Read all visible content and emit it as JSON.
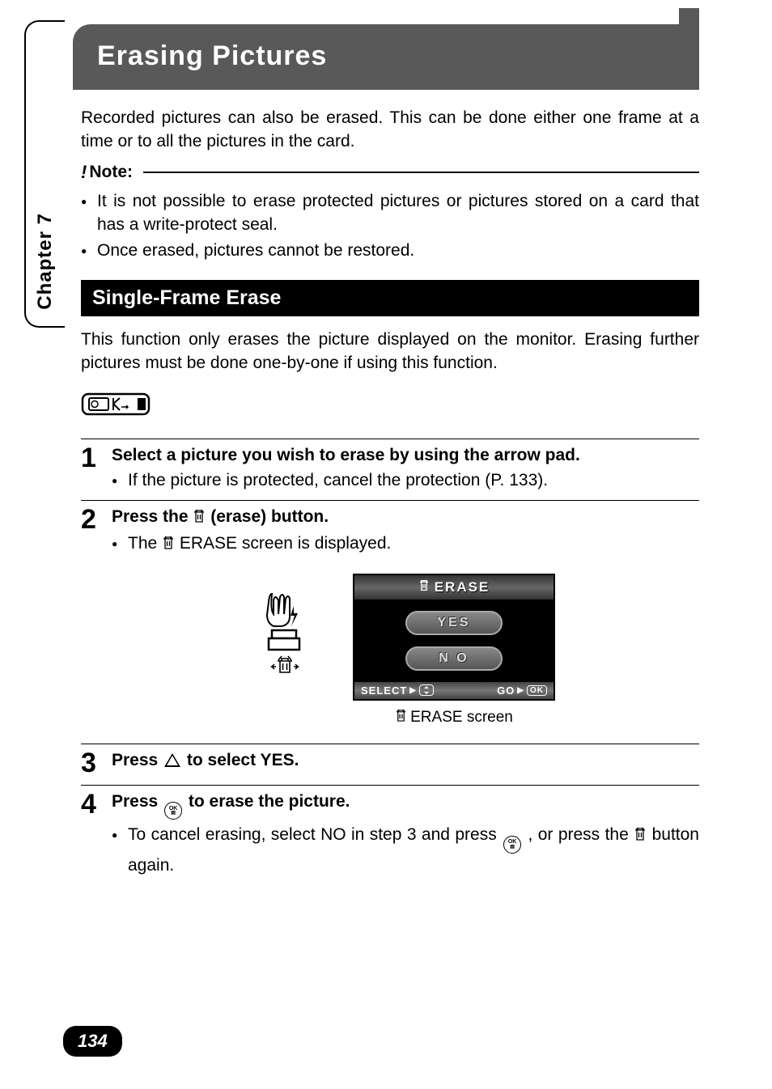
{
  "chapter_tab": "Chapter 7",
  "page_number": "134",
  "title": "Erasing Pictures",
  "intro": "Recorded pictures can also be erased. This can be done either one frame at a time or to all the pictures in the card.",
  "note": {
    "label": "Note:",
    "items": [
      "It is not possible to erase protected pictures or pictures stored on a card that has a write-protect seal.",
      "Once erased, pictures cannot be restored."
    ]
  },
  "section": {
    "title": "Single-Frame Erase",
    "desc": "This function only erases the picture displayed on the monitor. Erasing further pictures must be done one-by-one if using this function."
  },
  "steps": {
    "1": {
      "title": "Select a picture you wish to erase by using the arrow pad.",
      "sub": "If the picture is protected, cancel the protection (P. 133)."
    },
    "2": {
      "title_before": "Press the ",
      "title_after": " (erase) button.",
      "sub_before": "The ",
      "sub_after": " ERASE screen is displayed."
    },
    "3": {
      "title_before": "Press ",
      "title_after": " to select YES."
    },
    "4": {
      "title_before": "Press ",
      "title_after": " to erase the picture.",
      "sub_before": "To cancel erasing, select NO in step 3 and press ",
      "sub_mid": " , or press the ",
      "sub_after": " button again."
    }
  },
  "erase_screen": {
    "header": "ERASE",
    "yes": "YES",
    "no": "N O",
    "select": "SELECT",
    "go": "GO",
    "ok": "OK",
    "caption": " ERASE screen"
  },
  "ok_button_text": "OK"
}
